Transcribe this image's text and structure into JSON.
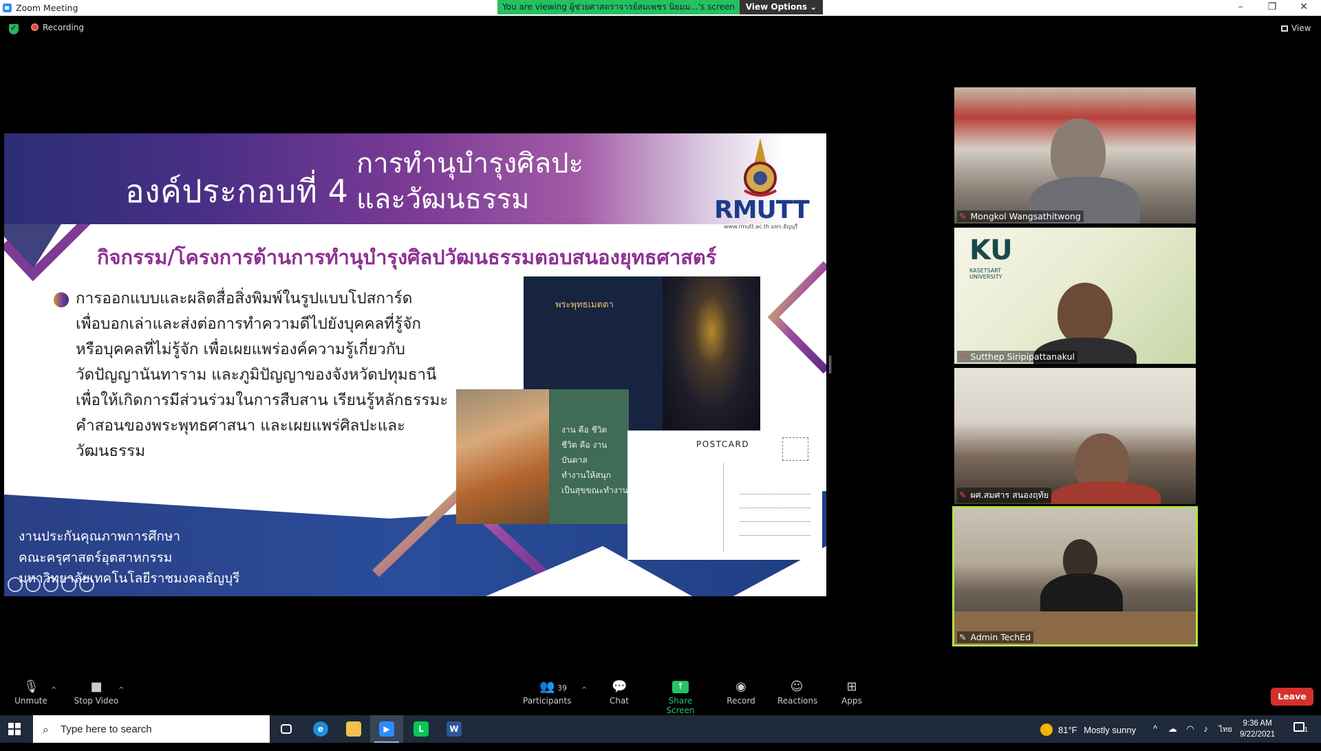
{
  "window": {
    "title": "Zoom Meeting",
    "viewing_banner": "You are viewing ผู้ช่วยศาสตราจารย์สมเพชร นิยมม...'s screen",
    "view_options": "View Options ⌄",
    "controls": {
      "minimize": "–",
      "restore": "❐",
      "close": "✕"
    }
  },
  "meeting": {
    "recording_label": "Recording",
    "view_label": "View"
  },
  "slide": {
    "title_main": "องค์ประกอบที่ 4",
    "title_sub_line1": "การทำนุบำรุงศิลปะ",
    "title_sub_line2": "และวัฒนธรรม",
    "logo_text": "RMUTT",
    "logo_caption": "www.rmutt.ac.th มทร.ธัญบุรี",
    "subtitle": "กิจกรรม/โครงการด้านการทำนุบำรุงศิลปวัฒนธรรมตอบสนองยุทธศาสตร์",
    "body_lines": [
      "การออกแบบและผลิตสื่อสิ่งพิมพ์ในรูปแบบโปสการ์ด",
      "เพื่อบอกเล่าและส่งต่อการทำความดีไปยังบุคคลที่รู้จัก",
      "หรือบุคคลที่ไม่รู้จัก เพื่อเผยแพร่องค์ความรู้เกี่ยวกับ",
      "วัดปัญญานันทาราม และภูมิปัญญาของจังหวัดปทุมธานี",
      "เพื่อให้เกิดการมีส่วนร่วมในการสืบสาน เรียนรู้หลักธรรมะ",
      "คำสอนของพระพุทธศาสนา และเผยแพร่ศิลปะและวัฒนธรรม"
    ],
    "postcard_front_title": "พระพุทธเมตตา",
    "green_card_lines": [
      "งาน คือ ชีวิต",
      "ชีวิต คือ งานบันดาล",
      "ทำงานให้สนุก",
      "เป็นสุขขณะทำงาน"
    ],
    "postcard_label": "POSTCARD",
    "footer_lines": [
      "งานประกันคุณภาพการศึกษา",
      "คณะครุศาสตร์อุตสาหกรรม",
      "มหาวิทยาลัยเทคโนโลยีราชมงคลธัญบุรี"
    ]
  },
  "participants": [
    {
      "name": "Mongkol Wangsathitwong",
      "muted": true
    },
    {
      "name": "Sutthep Siripipattanakul",
      "muted": true
    },
    {
      "name": "ผศ.สมศาร สนองฤทัย",
      "muted": true
    },
    {
      "name": "Admin TechEd",
      "muted": false
    }
  ],
  "ku_logo": {
    "mark": "KU",
    "caption_line1": "KASETSART",
    "caption_line2": "UNIVERSITY"
  },
  "toolbar": {
    "unmute": "Unmute",
    "stop_video": "Stop Video",
    "participants": "Participants",
    "participants_count": "39",
    "chat": "Chat",
    "share_screen": "Share Screen",
    "record": "Record",
    "reactions": "Reactions",
    "apps": "Apps",
    "leave": "Leave"
  },
  "taskbar": {
    "search_placeholder": "Type here to search",
    "weather_temp": "81°F",
    "weather_text": "Mostly sunny",
    "language": "ไทย",
    "time": "9:36 AM",
    "date": "9/22/2021",
    "notification_count": "1"
  },
  "colors": {
    "banner_green": "#25c15f",
    "leave_red": "#d5312b",
    "active_speaker_border": "#b4e04a",
    "slide_purple": "#8e2f94"
  }
}
